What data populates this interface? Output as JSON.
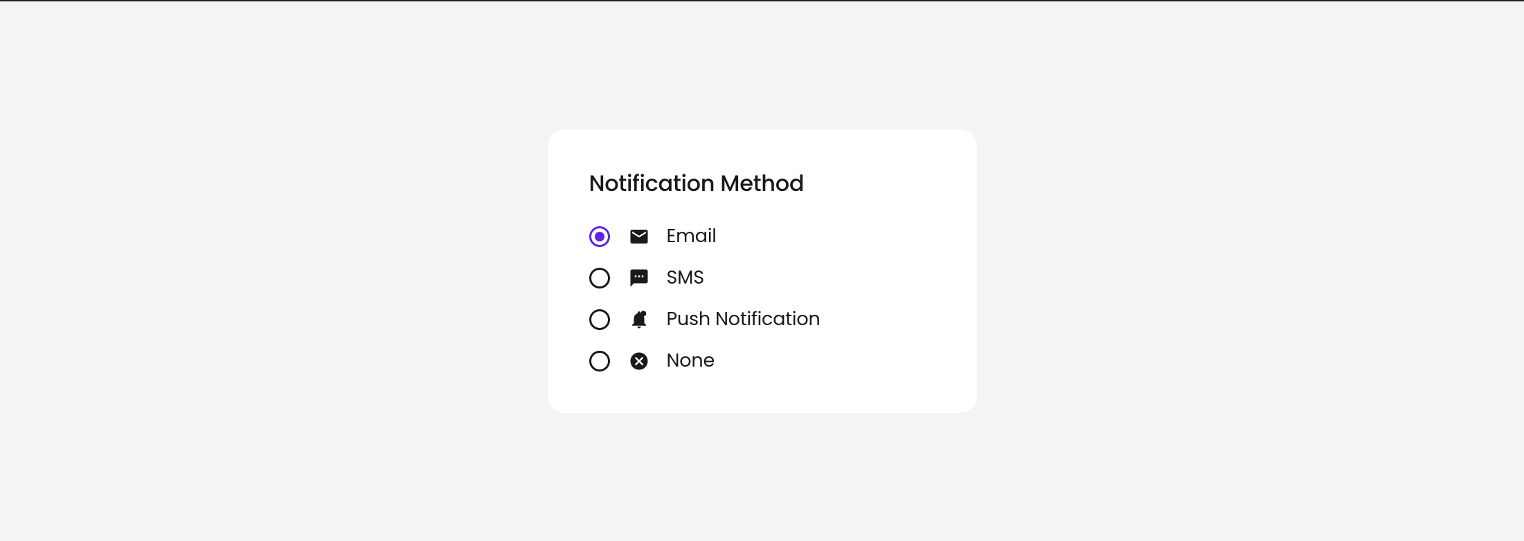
{
  "card": {
    "title": "Notification Method",
    "selectedIndex": 0,
    "options": [
      {
        "icon": "email-icon",
        "label": "Email"
      },
      {
        "icon": "sms-icon",
        "label": "SMS"
      },
      {
        "icon": "bell-icon",
        "label": "Push Notification"
      },
      {
        "icon": "cancel-icon",
        "label": "None"
      }
    ]
  },
  "colors": {
    "accent": "#6025e1",
    "text": "#1a1a1a",
    "background": "#f3f4f6",
    "card": "#ffffff"
  }
}
